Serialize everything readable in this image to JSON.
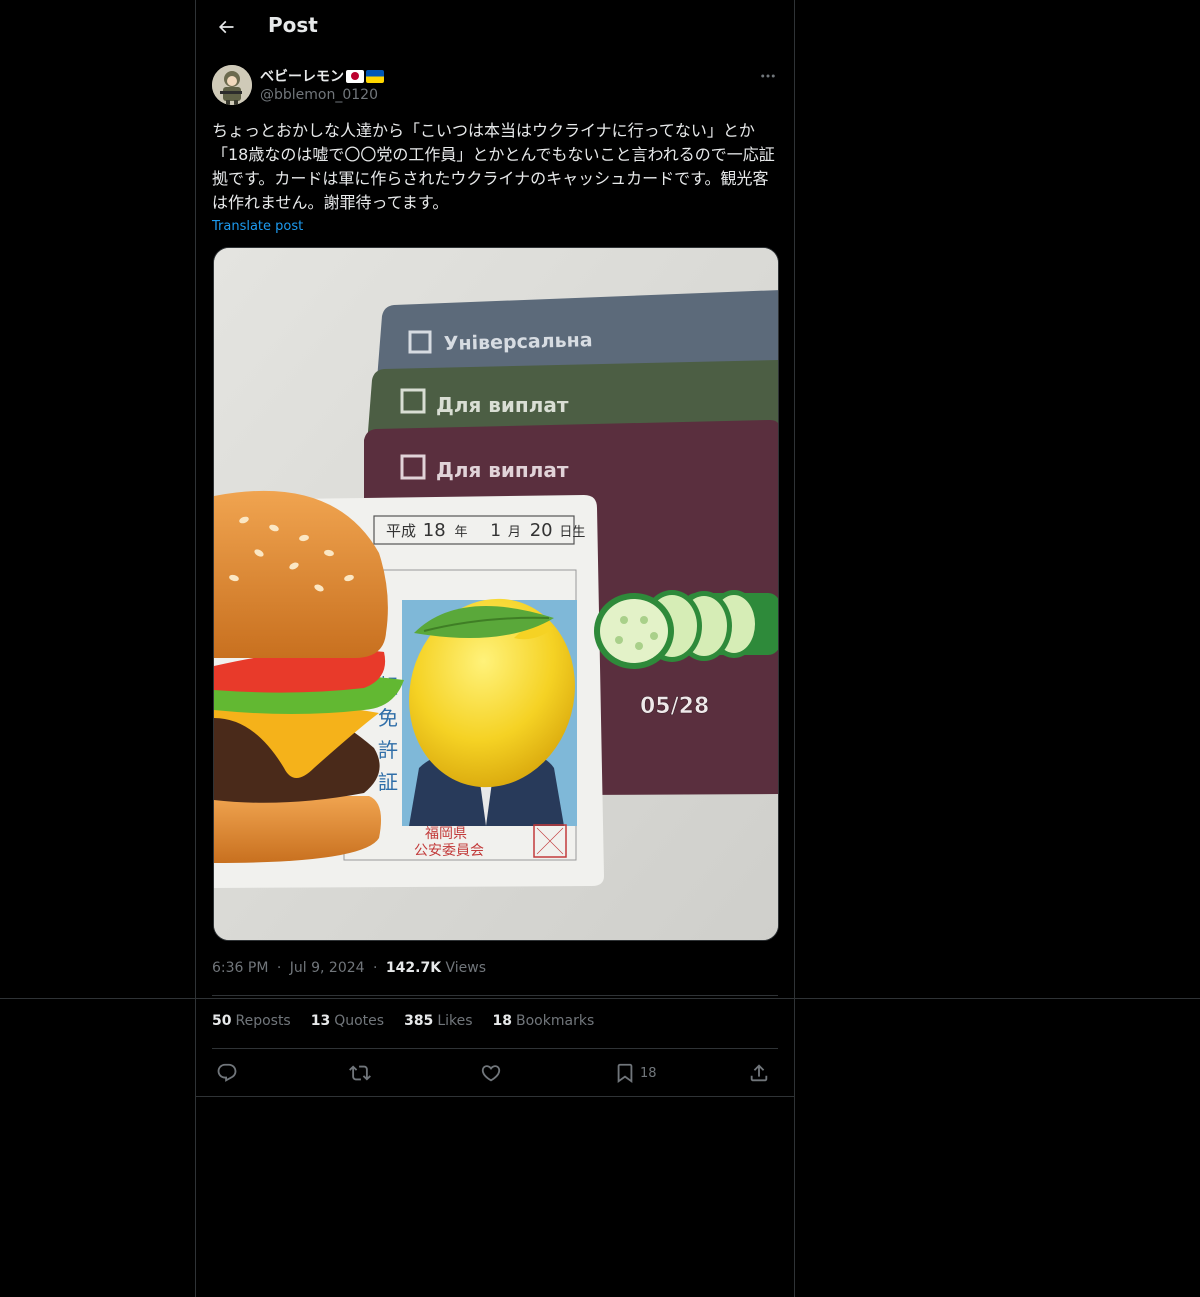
{
  "header": {
    "title": "Post"
  },
  "author": {
    "display_name": "ベビーレモン",
    "handle": "@bblemon_0120",
    "flags": [
      "japan-flag",
      "ukraine-flag"
    ]
  },
  "post": {
    "text": "ちょっとおかしな人達から「こいつは本当はウクライナに行ってない」とか「18歳なのは嘘で〇〇党の工作員」とかとんでもないこと言われるので一応証拠です。カードは軍に作らされたウクライナのキャッシュカードです。観光客は作れません。謝罪待ってます。",
    "translate_label": "Translate post"
  },
  "media": {
    "card1_text": "Універсальна",
    "card2_text": "Для виплат",
    "card3_text": "Для виплат",
    "card_expiry": "05/28",
    "license_date_era": "平成",
    "license_date_year": "18",
    "license_date_year_unit": "年",
    "license_date_month": "1",
    "license_date_month_unit": "月",
    "license_date_day": "20",
    "license_date_day_unit": "日生",
    "license_side_chars": [
      "転",
      "免",
      "許",
      "証"
    ],
    "license_issuer_line1": "福岡県",
    "license_issuer_line2": "公安委員会",
    "emoji_stickers": [
      "hamburger",
      "lemon",
      "cucumber"
    ]
  },
  "meta": {
    "time": "6:36 PM",
    "separator": "·",
    "date": "Jul 9, 2024",
    "views_count": "142.7K",
    "views_label": "Views"
  },
  "stats": {
    "reposts_count": "50",
    "reposts_label": "Reposts",
    "quotes_count": "13",
    "quotes_label": "Quotes",
    "likes_count": "385",
    "likes_label": "Likes",
    "bookmarks_count": "18",
    "bookmarks_label": "Bookmarks"
  },
  "actions": {
    "bookmark_count": "18"
  },
  "colors": {
    "background": "#000000",
    "border": "#2f3336",
    "text_primary": "#e7e9ea",
    "text_secondary": "#71767b",
    "link": "#1d9bf0"
  }
}
